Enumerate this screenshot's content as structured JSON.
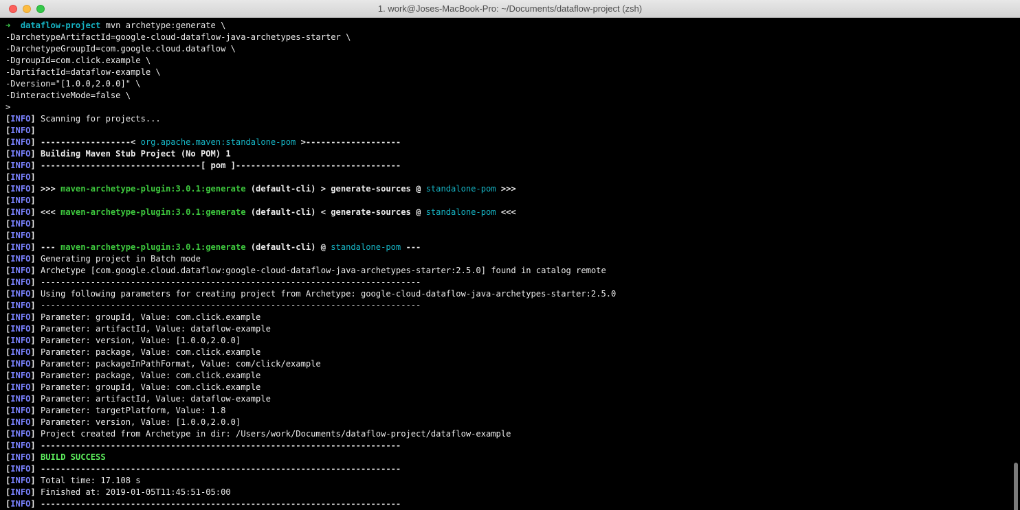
{
  "window": {
    "title": "1. work@Joses-MacBook-Pro: ~/Documents/dataflow-project (zsh)"
  },
  "prompt": {
    "arrow": "➜",
    "dir": "dataflow-project",
    "command": "mvn archetype:generate \\"
  },
  "command_continuation": [
    "-DarchetypeArtifactId=google-cloud-dataflow-java-archetypes-starter \\",
    "-DarchetypeGroupId=com.google.cloud.dataflow \\",
    "-DgroupId=com.click.example \\",
    "-DartifactId=dataflow-example \\",
    "-Dversion=\"[1.0.0,2.0.0]\" \\",
    "-DinteractiveMode=false \\",
    ">"
  ],
  "log": {
    "tag": "INFO",
    "scanning": "Scanning for projects...",
    "dashes_left": "------------------< ",
    "standalone_pom_full": "org.apache.maven:standalone-pom",
    "dashes_right": " >-------------------",
    "building": "Building Maven Stub Project (No POM) 1",
    "pom_line": "--------------------------------[ pom ]---------------------------------",
    "plugin": "maven-archetype-plugin:3.0.1:generate",
    "default_cli": "(default-cli)",
    "generate_sources": "generate-sources",
    "at": "@",
    "standalone_pom": "standalone-pom",
    "fwd_open": ">>>",
    "fwd_mid": ">",
    "fwd_close": ">>>",
    "back_open": "<<<",
    "back_mid": "<",
    "back_close": "<<<",
    "exec_open": "---",
    "exec_close": "---",
    "batch_mode": "Generating project in Batch mode",
    "archetype_found": "Archetype [com.google.cloud.dataflow:google-cloud-dataflow-java-archetypes-starter:2.5.0] found in catalog remote",
    "dashes_long": "----------------------------------------------------------------------------",
    "using_params": "Using following parameters for creating project from Archetype: google-cloud-dataflow-java-archetypes-starter:2.5.0",
    "parameters": [
      "Parameter: groupId, Value: com.click.example",
      "Parameter: artifactId, Value: dataflow-example",
      "Parameter: version, Value: [1.0.0,2.0.0]",
      "Parameter: package, Value: com.click.example",
      "Parameter: packageInPathFormat, Value: com/click/example",
      "Parameter: package, Value: com.click.example",
      "Parameter: groupId, Value: com.click.example",
      "Parameter: artifactId, Value: dataflow-example",
      "Parameter: targetPlatform, Value: 1.8",
      "Parameter: version, Value: [1.0.0,2.0.0]"
    ],
    "project_created": "Project created from Archetype in dir: /Users/work/Documents/dataflow-project/dataflow-example",
    "dashes_build": "------------------------------------------------------------------------",
    "build_success": "BUILD SUCCESS",
    "total_time": "Total time: 17.108 s",
    "finished_at": "Finished at: 2019-01-05T11:45:51-05:00"
  },
  "colors": {
    "background": "#000000",
    "text": "#ececec",
    "prompt_arrow": "#3fd44f",
    "info_tag": "#7a82ff",
    "cyan": "#16b4c4",
    "green": "#3ec93e",
    "build_success": "#5ef25e"
  },
  "icons": {
    "close": "red-traffic-light",
    "minimize": "yellow-traffic-light",
    "maximize": "green-traffic-light"
  }
}
